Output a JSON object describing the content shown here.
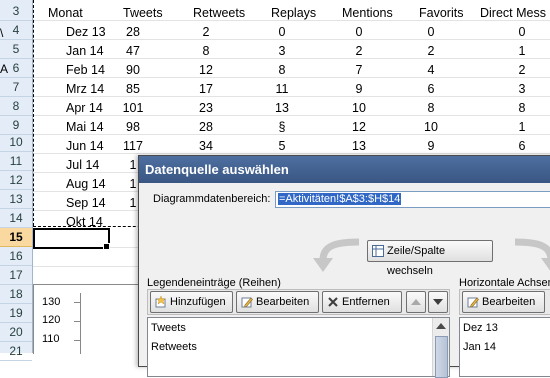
{
  "row_numbers": [
    "3",
    "4",
    "5",
    "6",
    "7",
    "8",
    "9",
    "10",
    "11",
    "12",
    "13",
    "14",
    "15",
    "16",
    "17",
    "18",
    "19",
    "20",
    "21"
  ],
  "selected_row": "15",
  "left_glyphs": [
    "\\",
    "A"
  ],
  "table": {
    "headers": [
      "Monat",
      "Tweets",
      "Retweets",
      "Replays",
      "Mentions",
      "Favorits",
      "Direct Mess"
    ],
    "rows": [
      [
        "Dez 13",
        "28",
        "2",
        "0",
        "0",
        "0",
        "0"
      ],
      [
        "Jan 14",
        "47",
        "8",
        "3",
        "2",
        "2",
        "1"
      ],
      [
        "Feb 14",
        "90",
        "12",
        "8",
        "7",
        "4",
        "2"
      ],
      [
        "Mrz 14",
        "85",
        "17",
        "11",
        "9",
        "6",
        "3"
      ],
      [
        "Apr 14",
        "101",
        "23",
        "13",
        "10",
        "8",
        "8"
      ],
      [
        "Mai 14",
        "98",
        "28",
        "§",
        "12",
        "10",
        "1"
      ],
      [
        "Jun 14",
        "117",
        "34",
        "5",
        "13",
        "9",
        "6"
      ],
      [
        "Jul 14",
        "1",
        "",
        "",
        "",
        "",
        ""
      ],
      [
        "Aug 14",
        "1",
        "",
        "",
        "",
        "",
        ""
      ],
      [
        "Sep 14",
        "1",
        "",
        "",
        "",
        "",
        ""
      ],
      [
        "Okt 14",
        "",
        "",
        "",
        "",
        "",
        ""
      ]
    ]
  },
  "chart": {
    "y_ticks": [
      "130",
      "120",
      "110"
    ]
  },
  "dialog": {
    "title": "Datenquelle auswählen",
    "range_label": "Diagrammdatenbereich:",
    "range_value": "=Aktivitäten!$A$3:$H$14",
    "switch_button": "Zeile/Spalte wechseln",
    "legend_label": "Legendeneinträge (Reihen)",
    "horizontal_label": "Horizontale Achsenb",
    "add_button": "Hinzufügen",
    "edit_button": "Bearbeiten",
    "remove_button": "Entfernen",
    "edit_button_right": "Bearbeiten",
    "series": [
      "Tweets",
      "Retweets"
    ],
    "categories": [
      "Dez 13",
      "Jan 14"
    ]
  },
  "colors": {
    "titlebar": "#3a5683",
    "selection": "#3168c6",
    "row_header": "#e4ecf7",
    "selected_row_header": "#f9d99f"
  }
}
